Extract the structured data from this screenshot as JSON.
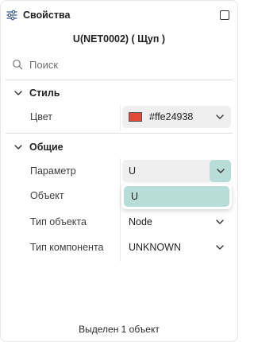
{
  "panel": {
    "title": "Свойства",
    "title_icon": "sliders-icon",
    "maximize_icon": "maximize-icon"
  },
  "object_name": "U(NET0002) ( Щуп )",
  "search": {
    "placeholder": "Поиск",
    "value": ""
  },
  "sections": {
    "style": {
      "title": "Стиль",
      "color_label": "Цвет",
      "color_value": "#ffe24938",
      "swatch_color": "#e24938"
    },
    "general": {
      "title": "Общие",
      "parameter_label": "Параметр",
      "parameter_value": "U",
      "parameter_options": [
        "U"
      ],
      "object_label": "Объект",
      "object_type_label": "Тип объекта",
      "object_type_value": "Node",
      "component_type_label": "Тип компонента",
      "component_type_value": "UNKNOWN"
    }
  },
  "footer": {
    "status": "Выделен 1 объект"
  },
  "colors": {
    "accent": "#b8dcd8",
    "field_bg": "#efefef",
    "divider": "#dedede"
  }
}
